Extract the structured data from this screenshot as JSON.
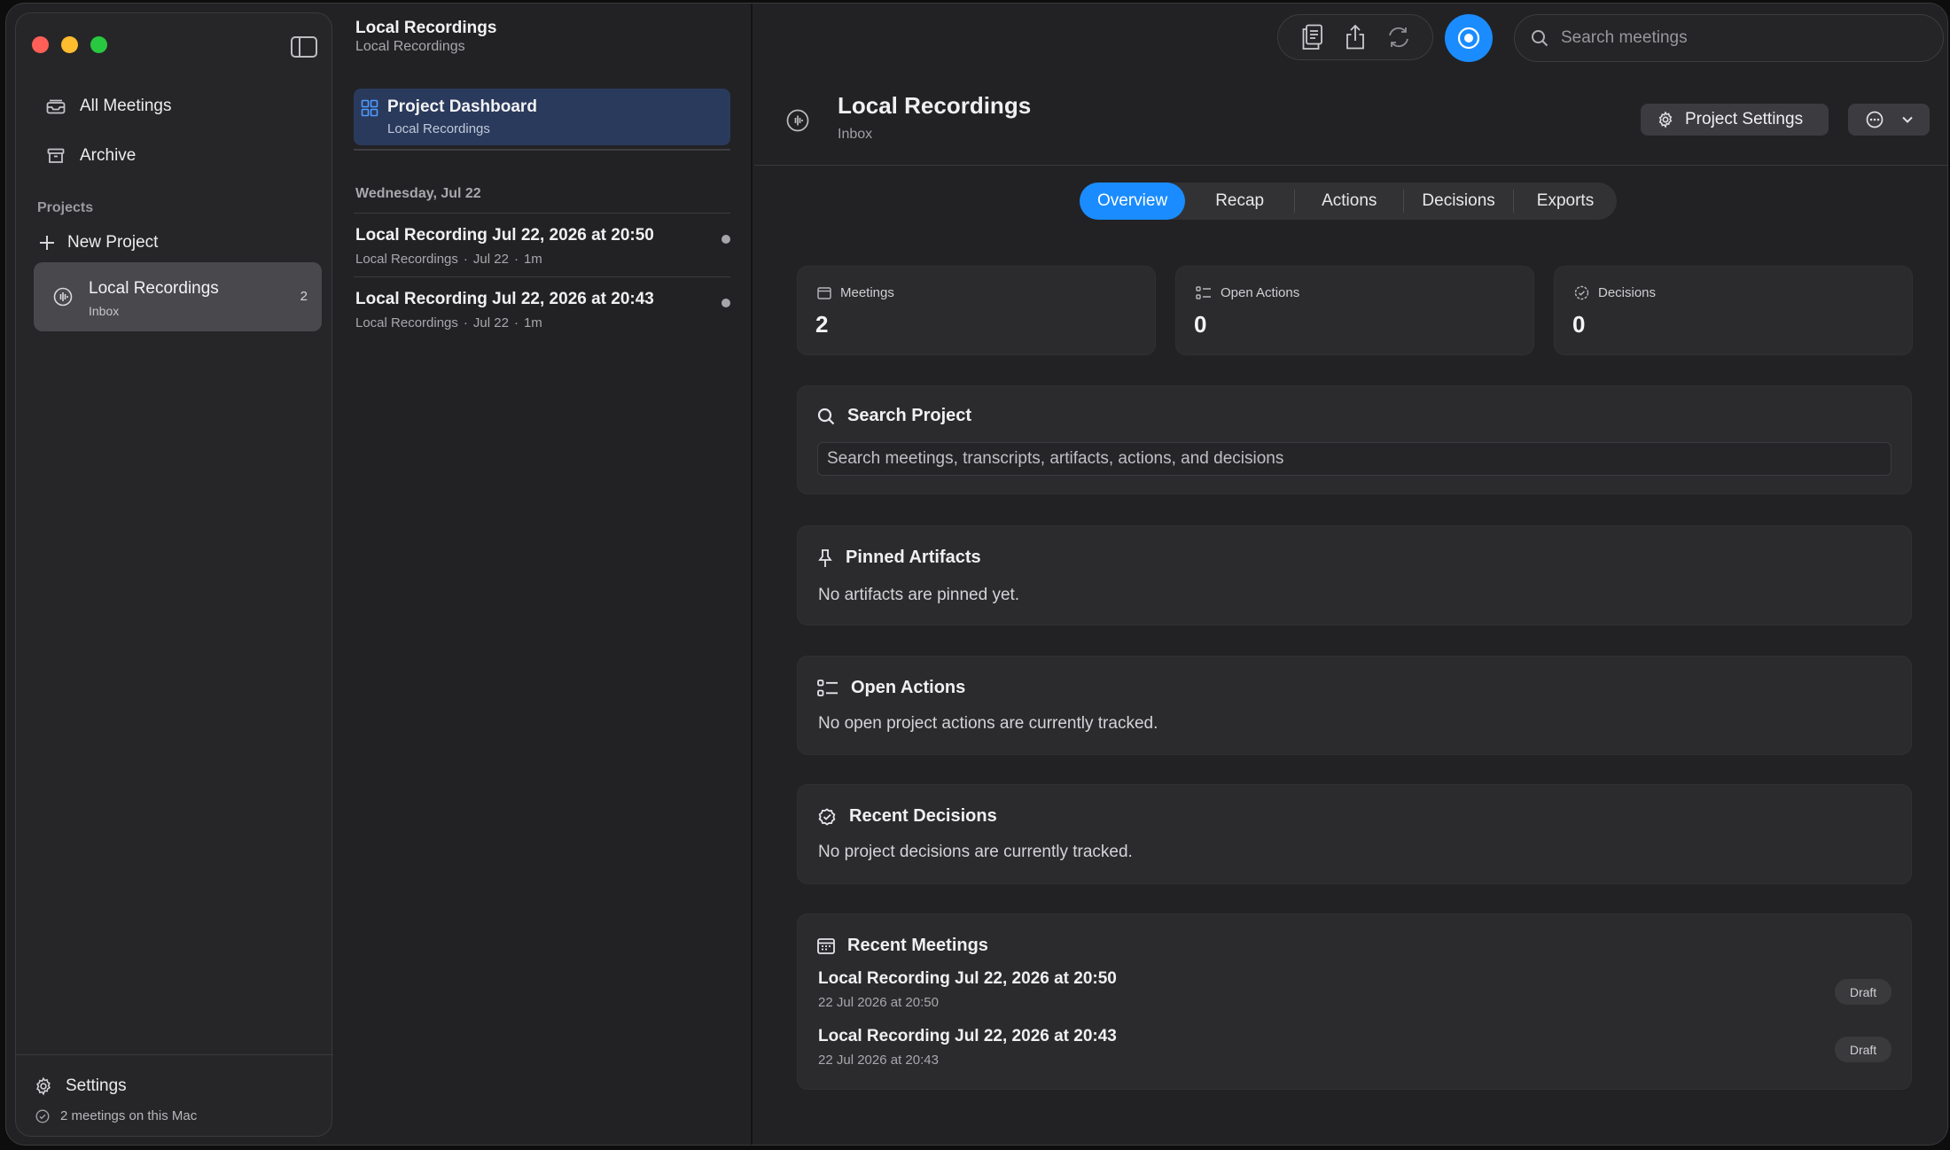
{
  "colors": {
    "accent": "#1a8cff",
    "close": "#ff5f57",
    "minimize": "#febc2e",
    "zoom": "#28c840"
  },
  "sidebar": {
    "nav": [
      {
        "label": "All Meetings",
        "icon": "inbox-stack-icon"
      },
      {
        "label": "Archive",
        "icon": "archive-box-icon"
      }
    ],
    "section_label": "Projects",
    "new_project_label": "New Project",
    "project": {
      "name": "Local Recordings",
      "subtitle": "Inbox",
      "count": "2",
      "icon": "waveform-circle-icon"
    },
    "settings_label": "Settings",
    "status_text": "2 meetings on this Mac"
  },
  "list": {
    "header_title": "Local Recordings",
    "header_subtitle": "Local Recordings",
    "dashboard": {
      "title": "Project Dashboard",
      "subtitle": "Local Recordings"
    },
    "date_group": "Wednesday, Jul 22",
    "meetings": [
      {
        "title": "Local Recording Jul 22, 2026 at 20:50",
        "project": "Local Recordings",
        "date": "Jul 22",
        "duration": "1m"
      },
      {
        "title": "Local Recording Jul 22, 2026 at 20:43",
        "project": "Local Recordings",
        "date": "Jul 22",
        "duration": "1m"
      }
    ]
  },
  "toolbar": {
    "search_placeholder": "Search meetings"
  },
  "main": {
    "title": "Local Recordings",
    "subtitle": "Inbox",
    "project_settings_label": "Project Settings",
    "tabs": [
      "Overview",
      "Recap",
      "Actions",
      "Decisions",
      "Exports"
    ],
    "active_tab": "Overview",
    "stats": [
      {
        "label": "Meetings",
        "value": "2"
      },
      {
        "label": "Open Actions",
        "value": "0"
      },
      {
        "label": "Decisions",
        "value": "0"
      }
    ],
    "search_project": {
      "title": "Search Project",
      "placeholder": "Search meetings, transcripts, artifacts, actions, and decisions"
    },
    "pinned": {
      "title": "Pinned Artifacts",
      "empty": "No artifacts are pinned yet."
    },
    "open_actions": {
      "title": "Open Actions",
      "empty": "No open project actions are currently tracked."
    },
    "recent_decisions": {
      "title": "Recent Decisions",
      "empty": "No project decisions are currently tracked."
    },
    "recent_meetings": {
      "title": "Recent Meetings",
      "items": [
        {
          "title": "Local Recording Jul 22, 2026 at 20:50",
          "date": "22 Jul 2026 at 20:50",
          "status": "Draft"
        },
        {
          "title": "Local Recording Jul 22, 2026 at 20:43",
          "date": "22 Jul 2026 at 20:43",
          "status": "Draft"
        }
      ]
    }
  }
}
